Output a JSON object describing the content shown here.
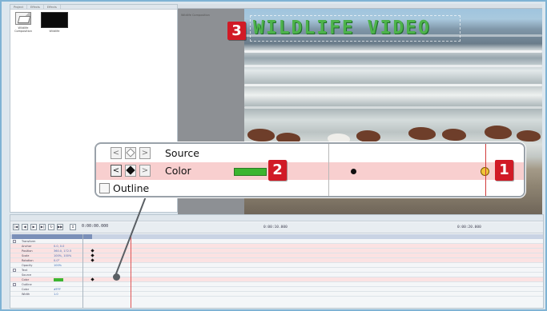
{
  "project": {
    "tabs": [
      "Project",
      "Effects",
      "Effects"
    ],
    "clips": [
      {
        "label": "Wildlife Composition",
        "icon": "composition-icon"
      },
      {
        "label": "Wildlife",
        "icon": "video-clip-icon"
      }
    ]
  },
  "monitor": {
    "title": "Wildlife Composition",
    "overlay_text": "WILDLIFE VIDEO",
    "overlay_color": "#4db34b"
  },
  "badges": {
    "one": "1",
    "two": "2",
    "three": "3"
  },
  "zoom": {
    "rows": {
      "source_label": "Source",
      "color_label": "Color",
      "outline_label": "Outline"
    },
    "swatch_color": "#3cb52f",
    "keyframe_color": "#f0c43a"
  },
  "timeline": {
    "tab_label": "Wildlife Composition ×",
    "timecode": "0:00:00.000",
    "ticks": [
      "0:00:10.000",
      "0:00:20.000"
    ],
    "layer_name": "Wildlife Video",
    "rows": [
      {
        "name": "Transform",
        "value": ""
      },
      {
        "name": "Anchor",
        "value": "0.0, 0.0"
      },
      {
        "name": "Position",
        "value": "360.0, 172.5"
      },
      {
        "name": "Scale",
        "value": "100%, 100%"
      },
      {
        "name": "Rotation",
        "value": "0.0°"
      },
      {
        "name": "Opacity",
        "value": "100%"
      },
      {
        "name": "Text",
        "value": ""
      },
      {
        "name": "Source",
        "value": ""
      },
      {
        "name": "Color",
        "value": ""
      },
      {
        "name": "Outline",
        "value": ""
      },
      {
        "name": "Color",
        "value": "#FFF"
      },
      {
        "name": "Width",
        "value": "1.0"
      }
    ]
  }
}
